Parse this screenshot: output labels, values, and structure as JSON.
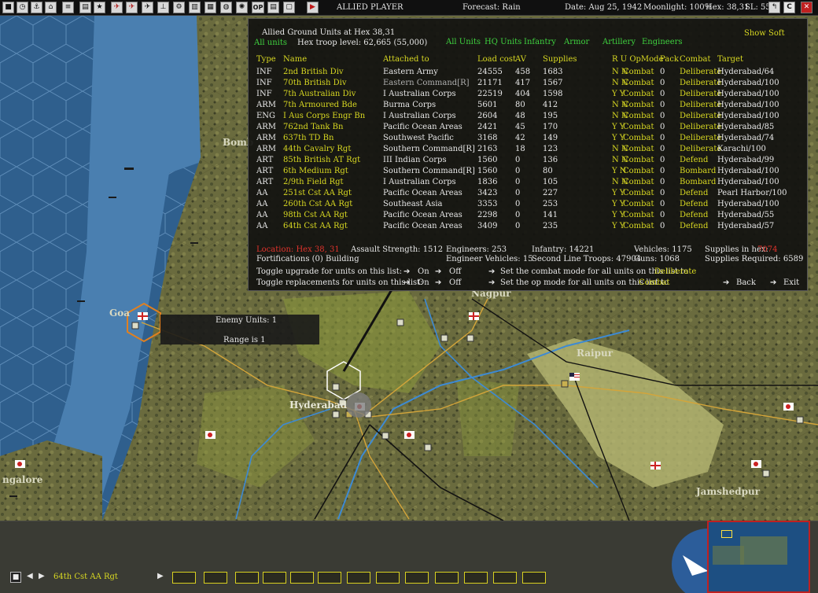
{
  "top_bar": {
    "player": "ALLIED PLAYER",
    "forecast": "Forecast: Rain",
    "date": "Date: Aug 25, 1942",
    "moonlight": "Moonlight: 100%",
    "hex": "Hex: 38,31",
    "sl": "SL: 55",
    "buttons": [
      "close-map-icon",
      "corner-button"
    ],
    "op_label": "OP"
  },
  "panel": {
    "title": "Allied Ground Units at Hex 38,31",
    "all_units_label": "All units",
    "hex_troop_level": "Hex troop level: 62,665  (55,000)",
    "filters": [
      "All Units",
      "HQ Units",
      "Infantry",
      "Armor",
      "Artillery",
      "Engineers"
    ],
    "show_soft": "Show Soft",
    "columns": [
      "Type",
      "Name",
      "Attached to",
      "Load cost",
      "AV",
      "Supplies",
      "R U OpMode",
      "Pack",
      "Combat",
      "Target"
    ],
    "rows": [
      {
        "type": "INF",
        "name": "2nd British Div",
        "attached": "Eastern Army",
        "load": "24555",
        "av": "458",
        "supplies": "1683",
        "ru": "N N",
        "opmode": "Combat",
        "pack": "0",
        "combat": "Deliberate",
        "target": "Hyderabad/64",
        "attached_gray": false
      },
      {
        "type": "INF",
        "name": "70th British Div",
        "attached": "Eastern Command[R]",
        "load": "21171",
        "av": "417",
        "supplies": "1567",
        "ru": "N N",
        "opmode": "Combat",
        "pack": "0",
        "combat": "Deliberate",
        "target": "Hyderabad/100",
        "attached_gray": true
      },
      {
        "type": "INF",
        "name": "7th Australian Div",
        "attached": "I Australian Corps",
        "load": "22519",
        "av": "404",
        "supplies": "1598",
        "ru": "Y Y",
        "opmode": "Combat",
        "pack": "0",
        "combat": "Deliberate",
        "target": "Hyderabad/100",
        "attached_gray": false
      },
      {
        "type": "ARM",
        "name": "7th Armoured Bde",
        "attached": "Burma Corps",
        "load": "5601",
        "av": "80",
        "supplies": "412",
        "ru": "N N",
        "opmode": "Combat",
        "pack": "0",
        "combat": "Deliberate",
        "target": "Hyderabad/100",
        "attached_gray": false
      },
      {
        "type": "ENG",
        "name": "I Aus Corps Engr Bn",
        "attached": "I Australian Corps",
        "load": "2604",
        "av": "48",
        "supplies": "195",
        "ru": "N N",
        "opmode": "Combat",
        "pack": "0",
        "combat": "Deliberate",
        "target": "Hyderabad/100",
        "attached_gray": false
      },
      {
        "type": "ARM",
        "name": "762nd Tank Bn",
        "attached": "Pacific Ocean Areas",
        "load": "2421",
        "av": "45",
        "supplies": "170",
        "ru": "Y Y",
        "opmode": "Combat",
        "pack": "0",
        "combat": "Deliberate",
        "target": "Hyderabad/85",
        "attached_gray": false
      },
      {
        "type": "ARM",
        "name": "637th TD Bn",
        "attached": "Southwest Pacific",
        "load": "3168",
        "av": "42",
        "supplies": "149",
        "ru": "Y Y",
        "opmode": "Combat",
        "pack": "0",
        "combat": "Deliberate",
        "target": "Hyderabad/74",
        "attached_gray": false
      },
      {
        "type": "ARM",
        "name": "44th Cavalry Rgt",
        "attached": "Southern Command[R]",
        "load": "2163",
        "av": "18",
        "supplies": "123",
        "ru": "N N",
        "opmode": "Combat",
        "pack": "0",
        "combat": "Deliberate",
        "target": "Karachi/100",
        "attached_gray": false
      },
      {
        "type": "ART",
        "name": "85th British AT Rgt",
        "attached": "III Indian Corps",
        "load": "1560",
        "av": "0",
        "supplies": "136",
        "ru": "N N",
        "opmode": "Combat",
        "pack": "0",
        "combat": "Defend",
        "target": "Hyderabad/99",
        "attached_gray": false
      },
      {
        "type": "ART",
        "name": "6th Medium Rgt",
        "attached": "Southern Command[R]",
        "load": "1560",
        "av": "0",
        "supplies": "80",
        "ru": "Y N",
        "opmode": "Combat",
        "pack": "0",
        "combat": "Bombard",
        "target": "Hyderabad/100",
        "attached_gray": false
      },
      {
        "type": "ART",
        "name": "2/9th Field Rgt",
        "attached": "I Australian Corps",
        "load": "1836",
        "av": "0",
        "supplies": "105",
        "ru": "N N",
        "opmode": "Combat",
        "pack": "0",
        "combat": "Bombard",
        "target": "Hyderabad/100",
        "attached_gray": false
      },
      {
        "type": "AA",
        "name": "251st Cst AA Rgt",
        "attached": "Pacific Ocean Areas",
        "load": "3423",
        "av": "0",
        "supplies": "227",
        "ru": "Y Y",
        "opmode": "Combat",
        "pack": "0",
        "combat": "Defend",
        "target": "Pearl Harbor/100",
        "attached_gray": false
      },
      {
        "type": "AA",
        "name": "260th Cst AA Rgt",
        "attached": "Southeast Asia",
        "load": "3353",
        "av": "0",
        "supplies": "253",
        "ru": "Y Y",
        "opmode": "Combat",
        "pack": "0",
        "combat": "Defend",
        "target": "Hyderabad/100",
        "attached_gray": false
      },
      {
        "type": "AA",
        "name": "98th Cst AA Rgt",
        "attached": "Pacific Ocean Areas",
        "load": "2298",
        "av": "0",
        "supplies": "141",
        "ru": "Y Y",
        "opmode": "Combat",
        "pack": "0",
        "combat": "Defend",
        "target": "Hyderabad/55",
        "attached_gray": false
      },
      {
        "type": "AA",
        "name": "64th Cst AA Rgt",
        "attached": "Pacific Ocean Areas",
        "load": "3409",
        "av": "0",
        "supplies": "235",
        "ru": "Y Y",
        "opmode": "Combat",
        "pack": "0",
        "combat": "Defend",
        "target": "Hyderabad/57",
        "attached_gray": false
      }
    ],
    "summary": {
      "location": "Location: Hex 38, 31",
      "assault": "Assault Strength: 1512",
      "engineers": "Engineers: 253",
      "infantry": "Infantry: 14221",
      "vehicles": "Vehicles: 1175",
      "supplies_in_hex_label": "Supplies in hex:",
      "supplies_in_hex_value": "7074",
      "fortifications": "Fortifications (0) Building",
      "eng_vehicles": "Engineer Vehicles:  15",
      "second_line": "Second Line Troops: 47904",
      "guns": "Guns: 1068",
      "supplies_required": "Supplies Required:  6589"
    },
    "toggles": {
      "upgrade_label": "Toggle upgrade for units on this list:",
      "replace_label": "Toggle replacements for units on this list:",
      "on": "On",
      "off": "Off",
      "combat_mode_label": "Set the combat mode for all units on this list to",
      "combat_mode_value": "Deliberate",
      "op_mode_label": "Set the op mode for all units on this list to",
      "op_mode_value": "Combat",
      "back": "Back",
      "exit": "Exit"
    }
  },
  "map": {
    "places": [
      "Bomb",
      "Goa",
      "Nagpur",
      "Raipur",
      "Hyderabad",
      "ngalore",
      "Jamshedpur"
    ]
  },
  "tooltip": {
    "enemy": "Enemy Units: 1",
    "range": "Range is 1"
  },
  "bottom_bar": {
    "selected_unit": "64th Cst AA Rgt"
  },
  "colors": {
    "panel_bg": "#12120f",
    "highlight_yellow": "#d8d822",
    "filter_green": "#3fd23f",
    "location_red": "#e0332c",
    "sea": "#3d6f9a",
    "land": "#6e6e3a"
  }
}
